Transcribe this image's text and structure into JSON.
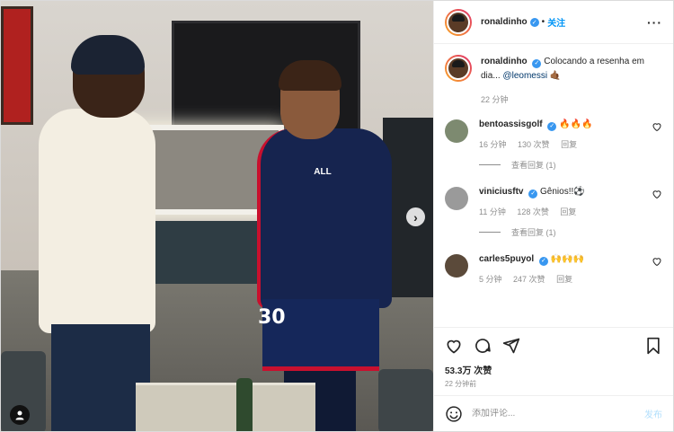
{
  "header": {
    "username": "ronaldinho",
    "separator": "•",
    "follow_label": "关注",
    "more_icon": "more-horizontal-icon",
    "verified_icon": "verified-badge-icon"
  },
  "caption": {
    "username": "ronaldinho",
    "text": "Colocando a resenha em dia... ",
    "mention": "@leomessi",
    "emoji": "🤙🏾",
    "time": "22 分钟"
  },
  "comments": [
    {
      "username": "bentoassisgolf",
      "text": "🔥🔥🔥",
      "time": "16 分钟",
      "likes": "130 次赞",
      "reply_label": "回复",
      "view_replies": "查看回复 (1)",
      "avatar_color": "#7d8a70"
    },
    {
      "username": "viniciusftv",
      "text": "Gênios!!⚽",
      "time": "11 分钟",
      "likes": "128 次赞",
      "reply_label": "回复",
      "view_replies": "查看回复 (1)",
      "avatar_color": "#9a9a9a"
    },
    {
      "username": "carles5puyol",
      "text": "🙌🙌🙌",
      "time": "5 分钟",
      "likes": "247 次赞",
      "reply_label": "回复",
      "avatar_color": "#5b4a3a"
    }
  ],
  "actions": {
    "like_icon": "heart-icon",
    "comment_icon": "comment-icon",
    "share_icon": "share-icon",
    "save_icon": "bookmark-icon"
  },
  "likes_count": "53.3万 次赞",
  "timestamp": "22 分钟前",
  "add_comment": {
    "placeholder": "添加评论...",
    "post_label": "发布",
    "emoji_icon": "emoji-icon"
  },
  "media": {
    "next_icon": "chevron-right-icon",
    "tag_icon": "user-tag-icon",
    "jersey_text": "ALL",
    "jersey_number": "30"
  },
  "colors": {
    "accent": "#0095f6",
    "verified": "#3897f0",
    "muted": "#8e8e8e",
    "text": "#262626"
  }
}
